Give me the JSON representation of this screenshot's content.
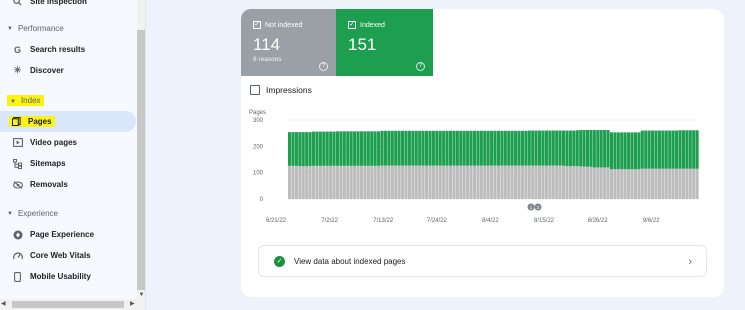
{
  "sidebar": {
    "top_item": "Site inspection",
    "sections": {
      "performance": "Performance",
      "index": "Index",
      "experience": "Experience"
    },
    "items": [
      {
        "label": "Search results",
        "icon": "google-g-icon"
      },
      {
        "label": "Discover",
        "icon": "asterisk-icon"
      },
      {
        "label": "Pages",
        "icon": "pages-icon"
      },
      {
        "label": "Video pages",
        "icon": "video-pages-icon"
      },
      {
        "label": "Sitemaps",
        "icon": "sitemap-icon"
      },
      {
        "label": "Removals",
        "icon": "removals-icon"
      },
      {
        "label": "Page Experience",
        "icon": "page-experience-icon"
      },
      {
        "label": "Core Web Vitals",
        "icon": "speedometer-icon"
      },
      {
        "label": "Mobile Usability",
        "icon": "mobile-icon"
      }
    ]
  },
  "tiles": {
    "not_indexed": {
      "label": "Not indexed",
      "value": "114",
      "sub": "8 reasons",
      "help": "?"
    },
    "indexed": {
      "label": "Indexed",
      "value": "151",
      "help": "?"
    }
  },
  "impressions_label": "Impressions",
  "cta": {
    "text": "View data about indexed pages",
    "chevron": "›"
  },
  "colors": {
    "indexed": "#1e9e4f",
    "not_indexed": "#bdbdbd",
    "highlight": "#fbf316"
  },
  "chart_data": {
    "type": "bar",
    "stacked": true,
    "ylabel": "Pages",
    "ylim": [
      0,
      300
    ],
    "yticks": [
      "300",
      "200",
      "100",
      "0"
    ],
    "xticks": [
      "6/21/22",
      "7/2/22",
      "7/13/22",
      "7/24/22",
      "8/4/22",
      "8/15/22",
      "8/26/22",
      "9/6/22"
    ],
    "annotations": [
      "1",
      "2"
    ],
    "series": [
      {
        "name": "Not indexed",
        "values": [
          126,
          126,
          126,
          125,
          125,
          125,
          125,
          126,
          126,
          126,
          126,
          126,
          126,
          126,
          126,
          126,
          126,
          126,
          126,
          126,
          126,
          126,
          126,
          126,
          126,
          126,
          126,
          127,
          127,
          127,
          127,
          127,
          127,
          127,
          127,
          127,
          127,
          127,
          127,
          127,
          127,
          127,
          127,
          127,
          127,
          127,
          127,
          127,
          127,
          127,
          127,
          127,
          127,
          127,
          127,
          127,
          127,
          127,
          127,
          127,
          127,
          127,
          127,
          127,
          127,
          127,
          127,
          127,
          127,
          127,
          127,
          127,
          127,
          127,
          127,
          127,
          127,
          127,
          127,
          127,
          127,
          125,
          125,
          125,
          125,
          124,
          123,
          123,
          122,
          120,
          120,
          120,
          120,
          120,
          113,
          113,
          113,
          113,
          113,
          113,
          113,
          113,
          113,
          115,
          115,
          115,
          115,
          115,
          115,
          115,
          115,
          115,
          115,
          115,
          115,
          115,
          115,
          115,
          115,
          115
        ]
      },
      {
        "name": "Indexed",
        "values": [
          128,
          128,
          128,
          129,
          129,
          129,
          129,
          130,
          130,
          130,
          130,
          130,
          130,
          130,
          131,
          131,
          131,
          131,
          131,
          131,
          131,
          131,
          131,
          131,
          131,
          131,
          131,
          132,
          132,
          132,
          132,
          132,
          132,
          132,
          132,
          132,
          132,
          132,
          132,
          132,
          132,
          132,
          132,
          132,
          132,
          132,
          132,
          132,
          132,
          132,
          132,
          132,
          132,
          132,
          132,
          132,
          132,
          132,
          132,
          132,
          132,
          132,
          132,
          132,
          132,
          132,
          132,
          132,
          132,
          132,
          133,
          133,
          133,
          133,
          133,
          133,
          133,
          133,
          133,
          133,
          133,
          135,
          135,
          135,
          136,
          138,
          139,
          139,
          140,
          142,
          142,
          142,
          142,
          142,
          140,
          140,
          140,
          140,
          140,
          140,
          140,
          140,
          140,
          145,
          145,
          145,
          145,
          145,
          145,
          145,
          145,
          145,
          145,
          145,
          146,
          146,
          146,
          146,
          146,
          146
        ]
      }
    ]
  }
}
